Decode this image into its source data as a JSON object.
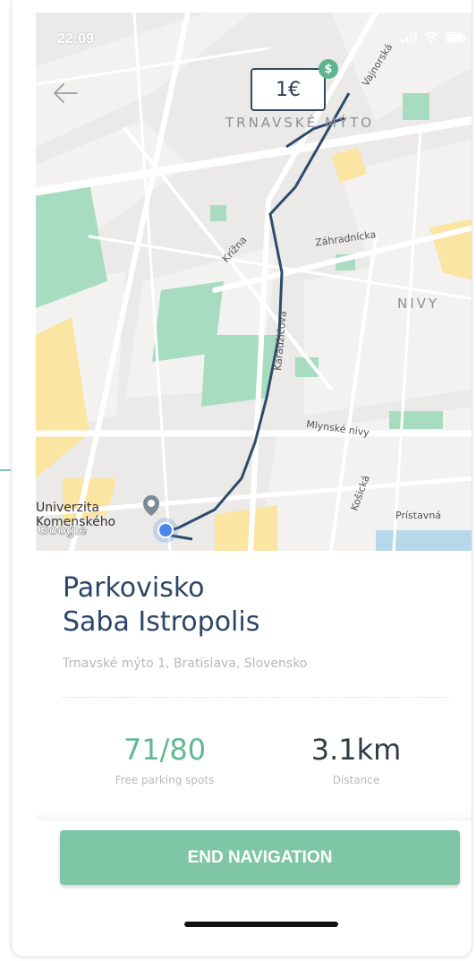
{
  "status_bar": {
    "time": "22:09",
    "location_icon": "location-arrow-icon",
    "signal_icon": "signal-icon",
    "wifi_icon": "wifi-icon",
    "battery_icon": "battery-icon"
  },
  "map": {
    "back_icon": "arrow-left-icon",
    "price": "1€",
    "price_badge": "$",
    "districts": [
      "TRNAVSKÉ MÝTO",
      "NIVY"
    ],
    "streets": [
      "Vajnorská",
      "Záhradnícka",
      "Krížna",
      "Karadžičova",
      "Mlynské nivy",
      "Košická",
      "Prístavná"
    ],
    "poi": "Univerzita Komenského",
    "google_logo": "Google",
    "current_location_icon": "current-location-dot-icon",
    "colors": {
      "route": "#2f4b6b",
      "park": "#a7dcc0",
      "accent_yellow": "#fbe5a3"
    }
  },
  "parking": {
    "title_line1": "Parkovisko",
    "title_line2": "Saba Istropolis",
    "address": "Trnavské mýto 1, Bratislava, Slovensko",
    "free_spots": "71/80",
    "free_spots_label": "Free parking spots",
    "distance": "3.1km",
    "distance_label": "Distance"
  },
  "actions": {
    "end_navigation": "END NAVIGATION"
  },
  "colors": {
    "title": "#2c4566",
    "spots": "#5fb88e",
    "button": "#7fc6a6"
  }
}
